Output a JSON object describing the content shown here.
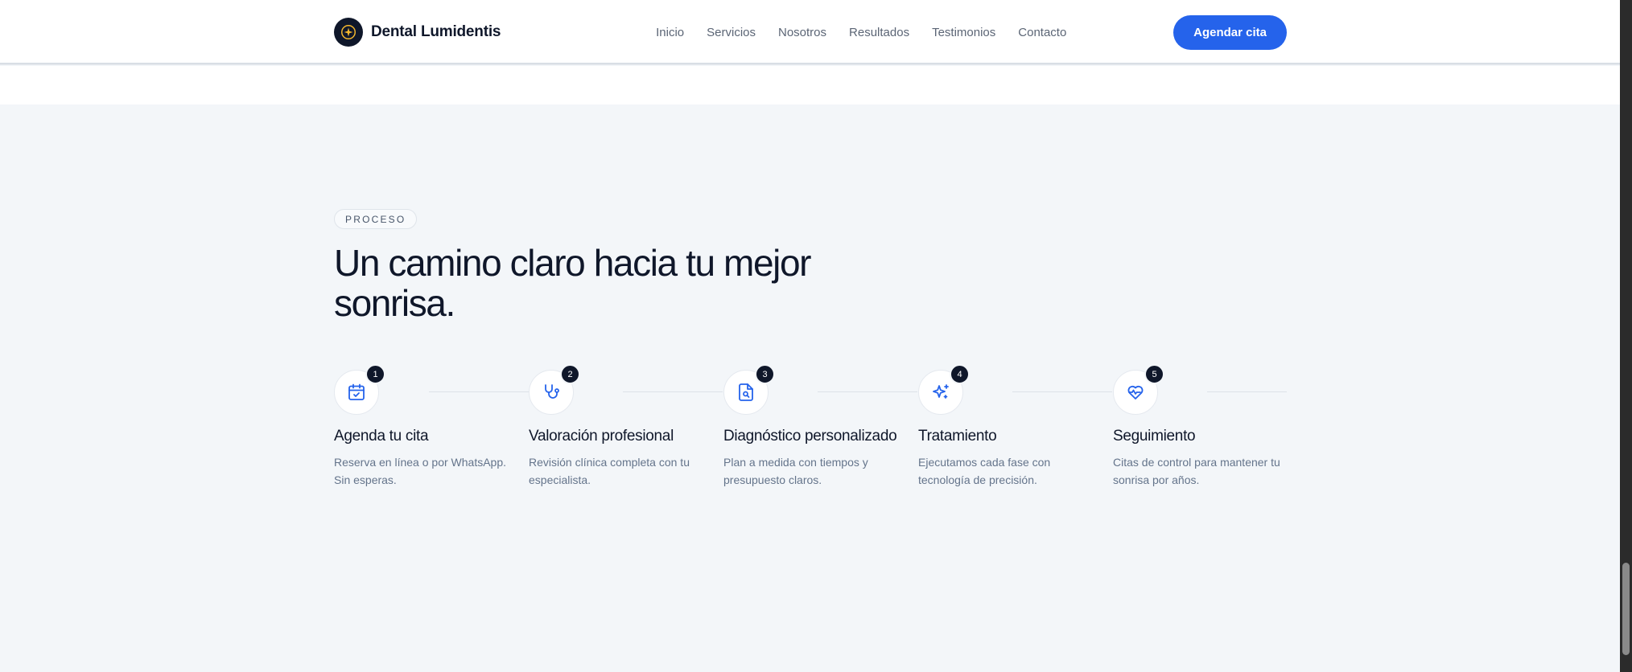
{
  "nav": {
    "brand": "Dental Lumidentis",
    "links": [
      "Inicio",
      "Servicios",
      "Nosotros",
      "Resultados",
      "Testimonios",
      "Contacto"
    ],
    "cta": "Agendar cita"
  },
  "process": {
    "eyebrow": "PROCESO",
    "title": "Un camino claro hacia tu mejor sonrisa.",
    "steps": [
      {
        "number": "1",
        "icon": "calendar-check-icon",
        "title": "Agenda tu cita",
        "description": "Reserva en línea o por WhatsApp. Sin esperas."
      },
      {
        "number": "2",
        "icon": "stethoscope-icon",
        "title": "Valoración profesional",
        "description": "Revisión clínica completa con tu especialista."
      },
      {
        "number": "3",
        "icon": "file-search-icon",
        "title": "Diagnóstico personalizado",
        "description": "Plan a medida con tiempos y presupuesto claros."
      },
      {
        "number": "4",
        "icon": "sparkles-icon",
        "title": "Tratamiento",
        "description": "Ejecutamos cada fase con tecnología de precisión."
      },
      {
        "number": "5",
        "icon": "heart-pulse-icon",
        "title": "Seguimiento",
        "description": "Citas de control para mantener tu sonrisa por años."
      }
    ]
  },
  "colors": {
    "accent": "#2563eb",
    "dark": "#0f172a",
    "logo_gold": "#f5b82e",
    "background": "#f3f6f9"
  }
}
